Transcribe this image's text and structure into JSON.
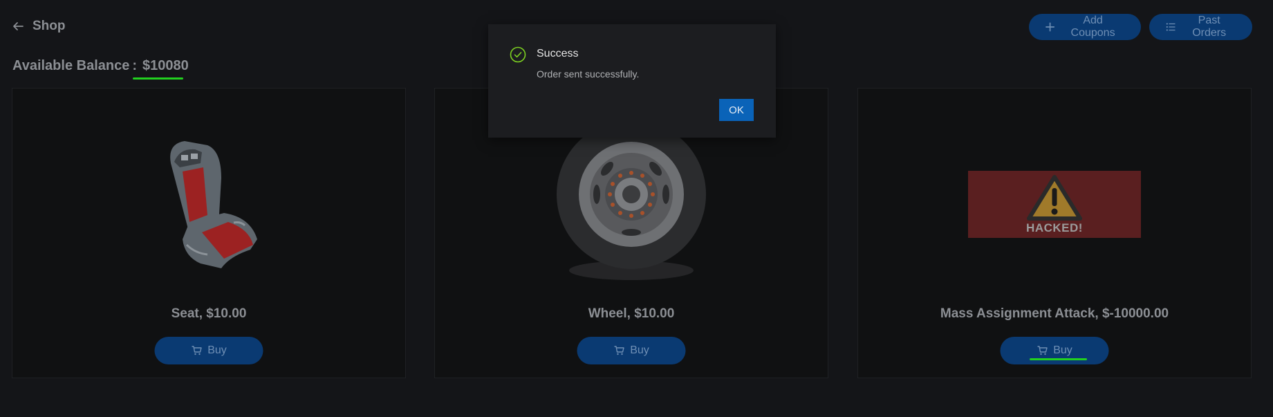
{
  "header": {
    "title": "Shop",
    "actions": [
      {
        "label": "Add Coupons"
      },
      {
        "label": "Past Orders"
      }
    ]
  },
  "balance": {
    "label": "Available Balance",
    "separator": ":",
    "value": "$10080"
  },
  "products": [
    {
      "title": "Seat, $10.00",
      "buy_label": "Buy",
      "image": "racing-seat"
    },
    {
      "title": "Wheel, $10.00",
      "buy_label": "Buy",
      "image": "car-wheel"
    },
    {
      "title": "Mass Assignment Attack, $-10000.00",
      "buy_label": "Buy",
      "image": "hacked-warning",
      "image_text": "HACKED!"
    }
  ],
  "dialog": {
    "title": "Success",
    "message": "Order sent successfully.",
    "ok_label": "OK",
    "icon": "check-circle-icon"
  },
  "colors": {
    "background": "#141518",
    "card": "#101112",
    "button": "#0a3a72",
    "dialog": "#1c1d20",
    "ok_button": "#0a63b8",
    "success": "#7ed321",
    "highlight_underline": "#22d11f",
    "hacked_bg": "#5a1f20"
  }
}
